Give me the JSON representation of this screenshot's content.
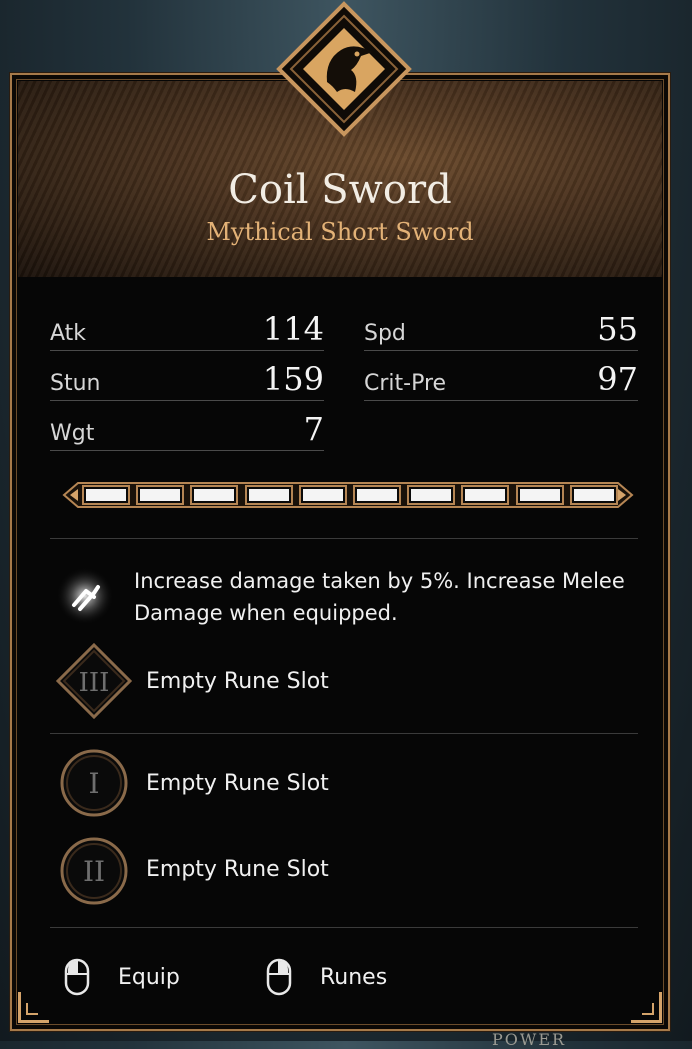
{
  "item": {
    "name": "Coil Sword",
    "type": "Mythical Short Sword"
  },
  "stats": {
    "atk": {
      "label": "Atk",
      "value": "114"
    },
    "stun": {
      "label": "Stun",
      "value": "159"
    },
    "wgt": {
      "label": "Wgt",
      "value": "7"
    },
    "spd": {
      "label": "Spd",
      "value": "55"
    },
    "crit": {
      "label": "Crit-Pre",
      "value": "97"
    }
  },
  "upgrade_bar": {
    "filled": 10,
    "total": 10
  },
  "perk": {
    "icon": "rune-glyph-icon",
    "text": "Increase damage taken by 5%. Increase Melee Damage when equipped."
  },
  "runes": [
    {
      "numeral": "III",
      "label": "Empty Rune Slot",
      "shape": "diamond"
    },
    {
      "numeral": "I",
      "label": "Empty Rune Slot",
      "shape": "circle"
    },
    {
      "numeral": "II",
      "label": "Empty Rune Slot",
      "shape": "circle"
    }
  ],
  "actions": [
    {
      "label": "Equip",
      "icon": "mouse-left-click-icon"
    },
    {
      "label": "Runes",
      "icon": "mouse-right-click-icon"
    }
  ],
  "background_hint": "POWER",
  "colors": {
    "accent": "#e3b277",
    "frame": "#a67a4a"
  }
}
